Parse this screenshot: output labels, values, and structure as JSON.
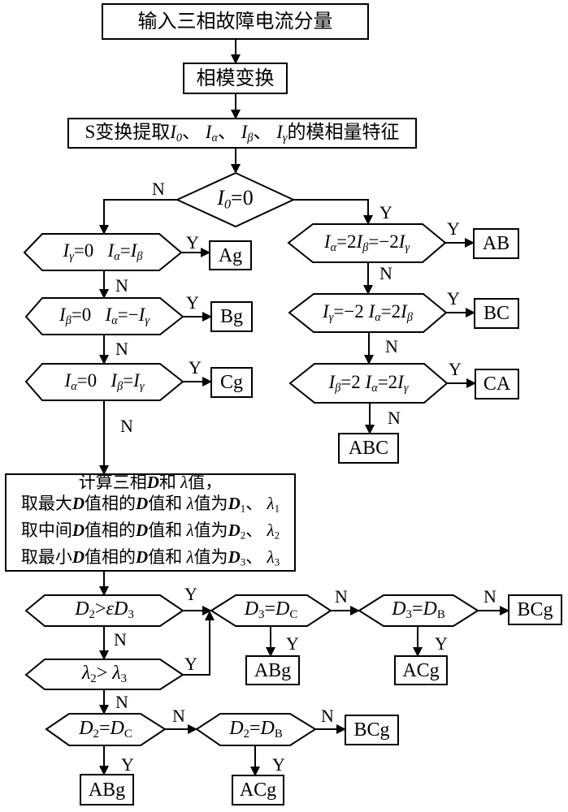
{
  "diagram": {
    "type": "flowchart",
    "colors": {
      "stroke": "#000000",
      "fill": "#ffffff",
      "text": "#000000"
    }
  },
  "nodes": {
    "input": {
      "kind": "process",
      "label": [
        [
          "输入三相故障电流分量",
          ""
        ]
      ]
    },
    "mode_transform": {
      "kind": "process",
      "label": [
        [
          "相模变换",
          ""
        ]
      ]
    },
    "s_transform": {
      "kind": "process",
      "label": [
        [
          "S变换提取",
          ""
        ],
        [
          "I",
          "i"
        ],
        [
          "0",
          "is"
        ],
        [
          "、 ",
          ""
        ],
        [
          "I",
          "i"
        ],
        [
          "α",
          "is"
        ],
        [
          "、 ",
          ""
        ],
        [
          "I",
          "i"
        ],
        [
          "β",
          "is"
        ],
        [
          "、 ",
          ""
        ],
        [
          "I",
          "i"
        ],
        [
          "γ",
          "is"
        ],
        [
          "的模相量特征",
          ""
        ]
      ]
    },
    "i0_zero": {
      "kind": "decision",
      "label": [
        [
          "I",
          "i"
        ],
        [
          "0",
          "is"
        ],
        [
          "=0",
          ""
        ]
      ]
    },
    "cond_ag": {
      "kind": "decision",
      "label": [
        [
          "I",
          "i"
        ],
        [
          "γ",
          "is"
        ],
        [
          "=0   ",
          ""
        ],
        [
          "I",
          "i"
        ],
        [
          "α",
          "is"
        ],
        [
          "=",
          ""
        ],
        [
          "I",
          "i"
        ],
        [
          "β",
          "is"
        ]
      ]
    },
    "cond_bg": {
      "kind": "decision",
      "label": [
        [
          "I",
          "i"
        ],
        [
          "β",
          "is"
        ],
        [
          "=0   ",
          ""
        ],
        [
          "I",
          "i"
        ],
        [
          "α",
          "is"
        ],
        [
          "=−",
          ""
        ],
        [
          "I",
          "i"
        ],
        [
          "γ",
          "is"
        ]
      ]
    },
    "cond_cg": {
      "kind": "decision",
      "label": [
        [
          "I",
          "i"
        ],
        [
          "α",
          "is"
        ],
        [
          "=0   ",
          ""
        ],
        [
          "I",
          "i"
        ],
        [
          "β",
          "is"
        ],
        [
          "=",
          ""
        ],
        [
          "I",
          "i"
        ],
        [
          "γ",
          "is"
        ]
      ]
    },
    "cond_ab": {
      "kind": "decision",
      "label": [
        [
          "I",
          "i"
        ],
        [
          "α",
          "is"
        ],
        [
          "=2",
          ""
        ],
        [
          "I",
          "i"
        ],
        [
          "β",
          "is"
        ],
        [
          "=−2",
          ""
        ],
        [
          "I",
          "i"
        ],
        [
          "γ",
          "is"
        ]
      ]
    },
    "cond_bc": {
      "kind": "decision",
      "label": [
        [
          "I",
          "i"
        ],
        [
          "γ",
          "is"
        ],
        [
          "=−2 ",
          ""
        ],
        [
          "I",
          "i"
        ],
        [
          "α",
          "is"
        ],
        [
          "=2",
          ""
        ],
        [
          "I",
          "i"
        ],
        [
          "β",
          "is"
        ]
      ]
    },
    "cond_ca": {
      "kind": "decision",
      "label": [
        [
          "I",
          "i"
        ],
        [
          "β",
          "is"
        ],
        [
          "=2 ",
          ""
        ],
        [
          "I",
          "i"
        ],
        [
          "α",
          "is"
        ],
        [
          "=2",
          ""
        ],
        [
          "I",
          "i"
        ],
        [
          "γ",
          "is"
        ]
      ]
    },
    "compute": {
      "kind": "process",
      "lines": [
        [
          [
            "计算三相",
            ""
          ],
          [
            "D",
            "bi"
          ],
          [
            "和 ",
            ""
          ],
          [
            "λ",
            "i"
          ],
          [
            "值，",
            ""
          ]
        ],
        [
          [
            "取最大",
            ""
          ],
          [
            "D",
            "bi"
          ],
          [
            "值相的",
            ""
          ],
          [
            "D",
            "bi"
          ],
          [
            "值和 ",
            ""
          ],
          [
            "λ",
            "i"
          ],
          [
            "值为",
            ""
          ],
          [
            "D",
            "bi"
          ],
          [
            "1",
            "s"
          ],
          [
            "、 ",
            ""
          ],
          [
            "λ",
            "i"
          ],
          [
            "1",
            "s"
          ]
        ],
        [
          [
            "取中间",
            ""
          ],
          [
            "D",
            "bi"
          ],
          [
            "值相的",
            ""
          ],
          [
            "D",
            "bi"
          ],
          [
            "值和 ",
            ""
          ],
          [
            "λ",
            "i"
          ],
          [
            "值为",
            ""
          ],
          [
            "D",
            "bi"
          ],
          [
            "2",
            "s"
          ],
          [
            "、 ",
            ""
          ],
          [
            "λ",
            "i"
          ],
          [
            "2",
            "s"
          ]
        ],
        [
          [
            "取最小",
            ""
          ],
          [
            "D",
            "bi"
          ],
          [
            "值相的",
            ""
          ],
          [
            "D",
            "bi"
          ],
          [
            "值和 ",
            ""
          ],
          [
            "λ",
            "i"
          ],
          [
            "值为",
            ""
          ],
          [
            "D",
            "bi"
          ],
          [
            "3",
            "s"
          ],
          [
            "、 ",
            ""
          ],
          [
            "λ",
            "i"
          ],
          [
            "3",
            "s"
          ]
        ]
      ]
    },
    "d2_gt_eps_d3": {
      "kind": "decision",
      "label": [
        [
          "D",
          "i"
        ],
        [
          "2",
          "s"
        ],
        [
          ">",
          ""
        ],
        [
          "ε",
          "i"
        ],
        [
          "D",
          "i"
        ],
        [
          "3",
          "s"
        ]
      ]
    },
    "lambda2_gt_lambda3": {
      "kind": "decision",
      "label": [
        [
          "λ",
          "i"
        ],
        [
          "2",
          "s"
        ],
        [
          "> ",
          ""
        ],
        [
          "λ",
          "i"
        ],
        [
          "3",
          "s"
        ]
      ]
    },
    "d3_eq_dc": {
      "kind": "decision",
      "label": [
        [
          "D",
          "i"
        ],
        [
          "3",
          "s"
        ],
        [
          "=",
          ""
        ],
        [
          "D",
          "i"
        ],
        [
          "C",
          "s"
        ]
      ]
    },
    "d3_eq_db": {
      "kind": "decision",
      "label": [
        [
          "D",
          "i"
        ],
        [
          "3",
          "s"
        ],
        [
          "=",
          ""
        ],
        [
          "D",
          "i"
        ],
        [
          "B",
          "s"
        ]
      ]
    },
    "d2_eq_dc": {
      "kind": "decision",
      "label": [
        [
          "D",
          "i"
        ],
        [
          "2",
          "s"
        ],
        [
          "=",
          ""
        ],
        [
          "D",
          "i"
        ],
        [
          "C",
          "s"
        ]
      ]
    },
    "d2_eq_db": {
      "kind": "decision",
      "label": [
        [
          "D",
          "i"
        ],
        [
          "2",
          "s"
        ],
        [
          "=",
          ""
        ],
        [
          "D",
          "i"
        ],
        [
          "B",
          "s"
        ]
      ]
    },
    "res_ag": {
      "kind": "result",
      "label": "Ag"
    },
    "res_bg": {
      "kind": "result",
      "label": "Bg"
    },
    "res_cg": {
      "kind": "result",
      "label": "Cg"
    },
    "res_ab": {
      "kind": "result",
      "label": "AB"
    },
    "res_bc": {
      "kind": "result",
      "label": "BC"
    },
    "res_ca": {
      "kind": "result",
      "label": "CA"
    },
    "res_abc": {
      "kind": "result",
      "label": "ABC"
    },
    "res_abg_1": {
      "kind": "result",
      "label": "ABg"
    },
    "res_acg_1": {
      "kind": "result",
      "label": "ACg"
    },
    "res_bcg_1": {
      "kind": "result",
      "label": "BCg"
    },
    "res_abg_2": {
      "kind": "result",
      "label": "ABg"
    },
    "res_acg_2": {
      "kind": "result",
      "label": "ACg"
    },
    "res_bcg_2": {
      "kind": "result",
      "label": "BCg"
    }
  },
  "edges": [
    {
      "from": "input",
      "to": "mode_transform",
      "label": ""
    },
    {
      "from": "mode_transform",
      "to": "s_transform",
      "label": ""
    },
    {
      "from": "s_transform",
      "to": "i0_zero",
      "label": ""
    },
    {
      "from": "i0_zero",
      "to": "cond_ag",
      "label": "N"
    },
    {
      "from": "i0_zero",
      "to": "cond_ab",
      "label": "Y"
    },
    {
      "from": "cond_ag",
      "to": "res_ag",
      "label": "Y"
    },
    {
      "from": "cond_ag",
      "to": "cond_bg",
      "label": "N"
    },
    {
      "from": "cond_bg",
      "to": "res_bg",
      "label": "Y"
    },
    {
      "from": "cond_bg",
      "to": "cond_cg",
      "label": "N"
    },
    {
      "from": "cond_cg",
      "to": "res_cg",
      "label": "Y"
    },
    {
      "from": "cond_cg",
      "to": "compute",
      "label": "N"
    },
    {
      "from": "cond_ab",
      "to": "res_ab",
      "label": "Y"
    },
    {
      "from": "cond_ab",
      "to": "cond_bc",
      "label": "N"
    },
    {
      "from": "cond_bc",
      "to": "res_bc",
      "label": "Y"
    },
    {
      "from": "cond_bc",
      "to": "cond_ca",
      "label": "N"
    },
    {
      "from": "cond_ca",
      "to": "res_ca",
      "label": "Y"
    },
    {
      "from": "cond_ca",
      "to": "res_abc",
      "label": "N"
    },
    {
      "from": "compute",
      "to": "d2_gt_eps_d3",
      "label": ""
    },
    {
      "from": "d2_gt_eps_d3",
      "to": "d3_eq_dc",
      "label": "Y"
    },
    {
      "from": "d2_gt_eps_d3",
      "to": "lambda2_gt_lambda3",
      "label": "N"
    },
    {
      "from": "lambda2_gt_lambda3",
      "to": "d3_eq_dc",
      "label": "Y"
    },
    {
      "from": "lambda2_gt_lambda3",
      "to": "d2_eq_dc",
      "label": "N"
    },
    {
      "from": "d3_eq_dc",
      "to": "res_abg_1",
      "label": "Y"
    },
    {
      "from": "d3_eq_dc",
      "to": "d3_eq_db",
      "label": "N"
    },
    {
      "from": "d3_eq_db",
      "to": "res_acg_1",
      "label": "Y"
    },
    {
      "from": "d3_eq_db",
      "to": "res_bcg_1",
      "label": "N"
    },
    {
      "from": "d2_eq_dc",
      "to": "res_abg_2",
      "label": "Y"
    },
    {
      "from": "d2_eq_dc",
      "to": "d2_eq_db",
      "label": "N"
    },
    {
      "from": "d2_eq_db",
      "to": "res_acg_2",
      "label": "Y"
    },
    {
      "from": "d2_eq_db",
      "to": "res_bcg_2",
      "label": "N"
    }
  ]
}
